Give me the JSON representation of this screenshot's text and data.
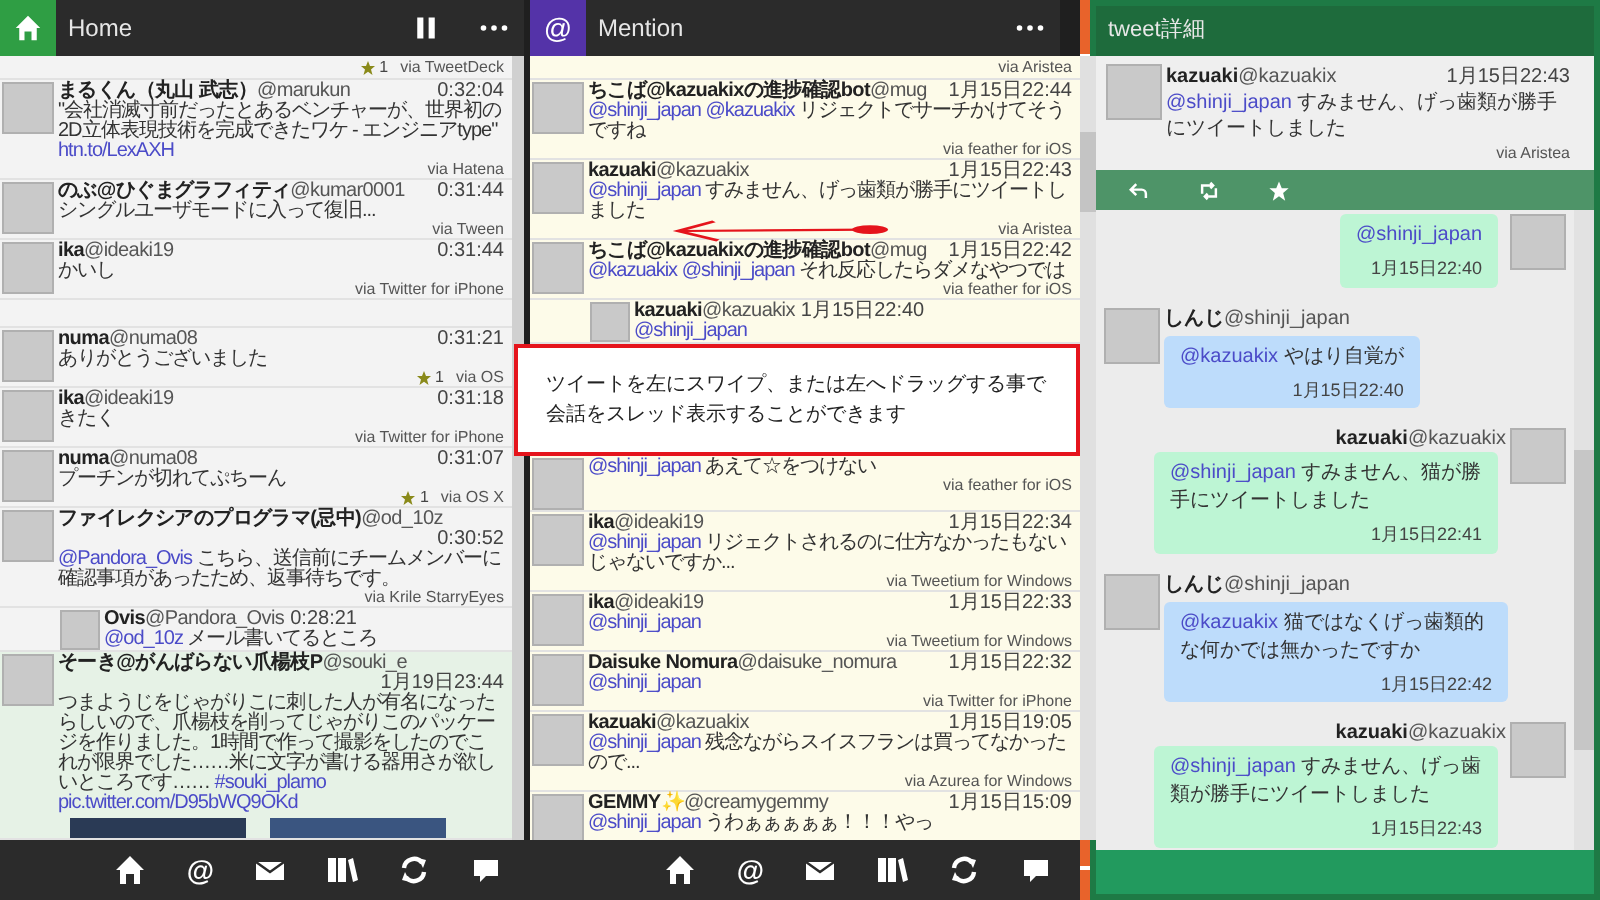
{
  "columns": [
    {
      "header": {
        "kind": "home",
        "title": "Home",
        "buttons": [
          {
            "kind": "pause"
          },
          {
            "kind": "more"
          }
        ]
      },
      "tweets": [
        {
          "kind": "stub",
          "favorites": "1",
          "via": "via TweetDeck"
        },
        {
          "kind": "tweet",
          "name": "まるくん（丸山 武志）",
          "handle": "@marukun",
          "time": "0:32:04",
          "segments": [
            {
              "kind": "text",
              "text": "\"会社消滅寸前だったとあるベンチャーが、世界初の2D立体表現技術を完成できたワケ - エンジニアtype\""
            },
            {
              "kind": "link",
              "text": "htn.to/LexAXH"
            }
          ],
          "via": "via Hatena"
        },
        {
          "kind": "tweet",
          "name": "のぶ@ひぐまグラフィティ",
          "handle": "@kumar0001",
          "time": "0:31:44",
          "segments": [
            {
              "kind": "text",
              "text": "シングルユーザモードに入って復旧..."
            }
          ],
          "via": "via Tween"
        },
        {
          "kind": "tweet",
          "name": "ika",
          "handle": "@ideaki19",
          "time": "0:31:44",
          "segments": [
            {
              "kind": "text",
              "text": "かいし"
            }
          ],
          "via": "via Twitter for iPhone"
        },
        {
          "kind": "gap"
        },
        {
          "kind": "tweet",
          "name": "numa",
          "handle": "@numa08",
          "time": "0:31:21",
          "segments": [
            {
              "kind": "text",
              "text": "ありがとうございました"
            }
          ],
          "favorites": "1",
          "via": "via OS"
        },
        {
          "kind": "tweet",
          "name": "ika",
          "handle": "@ideaki19",
          "time": "0:31:18",
          "segments": [
            {
              "kind": "text",
              "text": "きたく"
            }
          ],
          "via": "via Twitter for iPhone"
        },
        {
          "kind": "tweet",
          "name": "numa",
          "handle": "@numa08",
          "time": "0:31:07",
          "segments": [
            {
              "kind": "text",
              "text": "プーチンが切れてぷちーん"
            }
          ],
          "favorites": "1",
          "via": "via OS X"
        },
        {
          "kind": "tweet",
          "name": "ファイレクシアのプログラマ(忌中)",
          "handle": "@od_10z",
          "time": "0:30:52",
          "segments": [
            {
              "kind": "mention",
              "text": "@Pandora_Ovis"
            },
            {
              "kind": "text",
              "text": " こちら、送信前にチームメンバーに確認事項があったため、返事待ちです。"
            }
          ],
          "via": "via Krile StarryEyes"
        },
        {
          "kind": "reply",
          "name": "Ovis",
          "handle": "@Pandora_Ovis",
          "time": "0:28:21",
          "segments": [
            {
              "kind": "mention",
              "text": "@od_10z"
            },
            {
              "kind": "text",
              "text": " メール書いてるところ"
            }
          ]
        },
        {
          "kind": "media",
          "name": "そーき@がんばらない爪楊枝P",
          "handle": "@souki_e",
          "time": "1月19日23:44",
          "segments": [
            {
              "kind": "text",
              "text": "つまようじをじゃがりこに刺した人が有名になったらしいので、爪楊枝を削ってじゃがりこのパッケージを作りました。1時間で作って撮影をしたのでこれが限界でした……米に文字が書ける器用さが欲しいところです……  "
            },
            {
              "kind": "mention",
              "text": "#souki_plamo"
            },
            {
              "kind": "link",
              "text": "pic.twitter.com/D95bWQ9OKd"
            }
          ]
        }
      ]
    },
    {
      "header": {
        "kind": "at",
        "icon": "@",
        "title": "Mention",
        "buttons": [
          {
            "kind": "more"
          }
        ]
      },
      "tweets": [
        {
          "kind": "stub",
          "via": "via Aristea"
        },
        {
          "kind": "tweet",
          "name": "ちこば@kazuakixの進捗確認bot",
          "handle": "@mug",
          "time": "1月15日22:44",
          "segments": [
            {
              "kind": "mention",
              "text": "@shinji_japan @kazuakix"
            },
            {
              "kind": "text",
              "text": " リジェクトでサーチかけてそうですね"
            }
          ],
          "via": "via feather for iOS"
        },
        {
          "kind": "tweet",
          "name": "kazuaki",
          "handle": "@kazuakix",
          "time": "1月15日22:43",
          "segments": [
            {
              "kind": "mention",
              "text": "@shinji_japan"
            },
            {
              "kind": "text",
              "text": " すみません、げっ歯類が勝手にツイートしました"
            }
          ],
          "via": "via Aristea"
        },
        {
          "kind": "tweet",
          "name": "ちこば@kazuakixの進捗確認bot",
          "handle": "@mug",
          "time": "1月15日22:42",
          "segments": [
            {
              "kind": "mention",
              "text": "@kazuakix @shinji_japan"
            },
            {
              "kind": "text",
              "text": " それ反応したらダメなやつでは"
            }
          ],
          "via": "via feather for iOS"
        },
        {
          "kind": "reply",
          "name": "kazuaki",
          "handle": "@kazuakix",
          "time": "1月15日22:40",
          "segments": [
            {
              "kind": "mention",
              "text": "@shinji_japan"
            }
          ]
        },
        {
          "kind": "hint",
          "lines": [
            "ツイートを左にスワイプ、または左へドラッグする事で",
            "会話をスレッド表示することができます"
          ]
        },
        {
          "kind": "tweet",
          "segments": [
            {
              "kind": "mention",
              "text": "@shinji_japan"
            },
            {
              "kind": "text",
              "text": " あえて☆をつけない"
            }
          ],
          "via": "via feather for iOS"
        },
        {
          "kind": "tweet",
          "name": "ika",
          "handle": "@ideaki19",
          "time": "1月15日22:34",
          "segments": [
            {
              "kind": "mention",
              "text": "@shinji_japan"
            },
            {
              "kind": "text",
              "text": " リジェクトされるのに仕方なかったもないじゃないですか..."
            }
          ],
          "via": "via Tweetium for Windows"
        },
        {
          "kind": "tweet",
          "name": "ika",
          "handle": "@ideaki19",
          "time": "1月15日22:33",
          "segments": [
            {
              "kind": "mention",
              "text": "@shinji_japan"
            }
          ],
          "via": "via Tweetium for Windows"
        },
        {
          "kind": "tweet",
          "name": "Daisuke Nomura",
          "handle": "@daisuke_nomura",
          "time": "1月15日22:32",
          "segments": [
            {
              "kind": "mention",
              "text": "@shinji_japan"
            }
          ],
          "via": "via Twitter for iPhone"
        },
        {
          "kind": "tweet",
          "name": "kazuaki",
          "handle": "@kazuakix",
          "time": "1月15日19:05",
          "segments": [
            {
              "kind": "mention",
              "text": "@shinji_japan"
            },
            {
              "kind": "text",
              "text": " 残念ながらスイスフランは買ってなかったので..."
            }
          ],
          "via": "via Azurea for Windows"
        },
        {
          "kind": "tweet",
          "name": "GEMMY✨",
          "handle": "@creamygemmy",
          "time": "1月15日15:09",
          "segments": [
            {
              "kind": "mention",
              "text": "@shinji_japan"
            },
            {
              "kind": "text",
              "text": " うわぁぁぁぁぁ！！！やっ"
            }
          ]
        }
      ]
    }
  ],
  "toolbar": [
    {
      "kind": "home"
    },
    {
      "kind": "at",
      "label": "@"
    },
    {
      "kind": "mail"
    },
    {
      "kind": "books"
    },
    {
      "kind": "refresh"
    },
    {
      "kind": "chat"
    }
  ],
  "detail": {
    "title": "tweet詳細",
    "tweet": {
      "name": "kazuaki",
      "handle": "@kazuakix",
      "time": "1月15日22:43",
      "segments": [
        {
          "kind": "mention",
          "text": "@shinji_japan"
        },
        {
          "kind": "text",
          "text": " すみません、げっ歯類が勝手にツイートしました"
        }
      ],
      "via": "via Aristea"
    },
    "actions": [
      {
        "kind": "reply"
      },
      {
        "kind": "retweet"
      },
      {
        "kind": "favorite"
      }
    ],
    "conversation": [
      {
        "kind": "right",
        "segments": [
          {
            "kind": "mention",
            "text": "@shinji_japan"
          }
        ],
        "time": "1月15日22:40"
      },
      {
        "kind": "left",
        "name": "しんじ",
        "handle": "@shinji_japan",
        "segments": [
          {
            "kind": "mention",
            "text": "@kazuakix"
          },
          {
            "kind": "text",
            "text": " やはり自覚が"
          }
        ],
        "time": "1月15日22:40"
      },
      {
        "kind": "right",
        "name": "kazuaki",
        "handle": "@kazuakix",
        "segments": [
          {
            "kind": "mention",
            "text": "@shinji_japan"
          },
          {
            "kind": "text",
            "text": " すみません、猫が勝手にツイートしました"
          }
        ],
        "time": "1月15日22:41"
      },
      {
        "kind": "left",
        "name": "しんじ",
        "handle": "@shinji_japan",
        "segments": [
          {
            "kind": "mention",
            "text": "@kazuakix"
          },
          {
            "kind": "text",
            "text": "  猫ではなくげっ歯類的な何かでは無かったですか"
          }
        ],
        "time": "1月15日22:42"
      },
      {
        "kind": "right",
        "name": "kazuaki",
        "handle": "@kazuakix",
        "segments": [
          {
            "kind": "mention",
            "text": "@shinji_japan"
          },
          {
            "kind": "text",
            "text": " すみません、げっ歯類が勝手にツイートしました"
          }
        ],
        "time": "1月15日22:43"
      }
    ]
  }
}
